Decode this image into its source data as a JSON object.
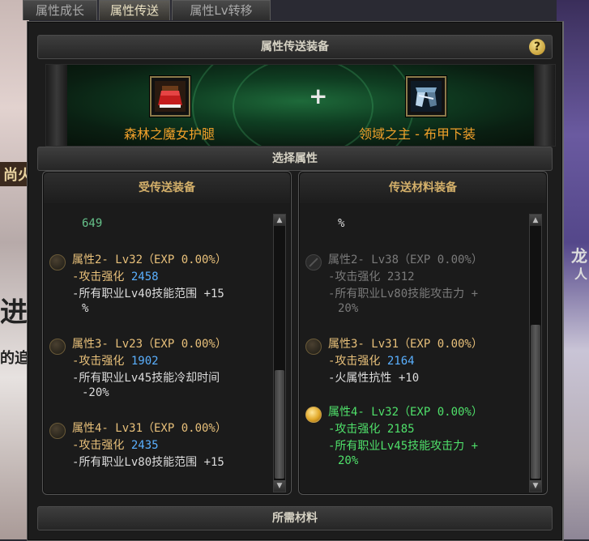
{
  "tabs": [
    "属性成长",
    "属性传送",
    "属性Lv转移"
  ],
  "active_tab": 1,
  "header": {
    "title": "属性传送装备",
    "help": "?"
  },
  "transfer": {
    "source_item": "森林之魔女护腿",
    "plus": "+",
    "target_item": "领域之主 - 布甲下装"
  },
  "select_bar": "选择属性",
  "left_panel": {
    "title": "受传送装备",
    "top_partial": "649",
    "attrs": [
      {
        "title": "属性2- Lv32（EXP 0.00%）",
        "stat_label": "-攻击强化",
        "stat_value": "2458",
        "effect": "-所有职业Lv40技能范围 +15",
        "effect_cont": "%",
        "state": "normal"
      },
      {
        "title": "属性3- Lv23（EXP 0.00%）",
        "stat_label": "-攻击强化",
        "stat_value": "1902",
        "effect": "-所有职业Lv45技能冷却时间",
        "effect_cont": "-20%",
        "state": "normal"
      },
      {
        "title": "属性4- Lv31（EXP 0.00%）",
        "stat_label": "-攻击强化",
        "stat_value": "2435",
        "effect": "-所有职业Lv80技能范围 +15",
        "effect_cont": "",
        "state": "normal"
      }
    ]
  },
  "right_panel": {
    "title": "传送材料装备",
    "top_partial": "%",
    "attrs": [
      {
        "title": "属性2- Lv38（EXP 0.00%）",
        "stat_label": "-攻击强化",
        "stat_value": "2312",
        "effect": "-所有职业Lv80技能攻击力 +",
        "effect_cont": "20%",
        "state": "disabled"
      },
      {
        "title": "属性3- Lv31（EXP 0.00%）",
        "stat_label": "-攻击强化",
        "stat_value": "2164",
        "effect": "-火属性抗性 +10",
        "effect_cont": "",
        "state": "normal"
      },
      {
        "title": "属性4- Lv32（EXP 0.00%）",
        "stat_label": "-攻击强化",
        "stat_value": "2185",
        "effect": "-所有职业Lv45技能攻击力 +",
        "effect_cont": "20%",
        "state": "selected"
      }
    ]
  },
  "materials_bar": "所需材料",
  "scroll": {
    "up": "▲",
    "down": "▼"
  },
  "background": {
    "left_text_1": "进",
    "left_text_2": "的追",
    "left_text_3": "尚火",
    "right_text_1": "龙",
    "right_text_2": "人"
  }
}
